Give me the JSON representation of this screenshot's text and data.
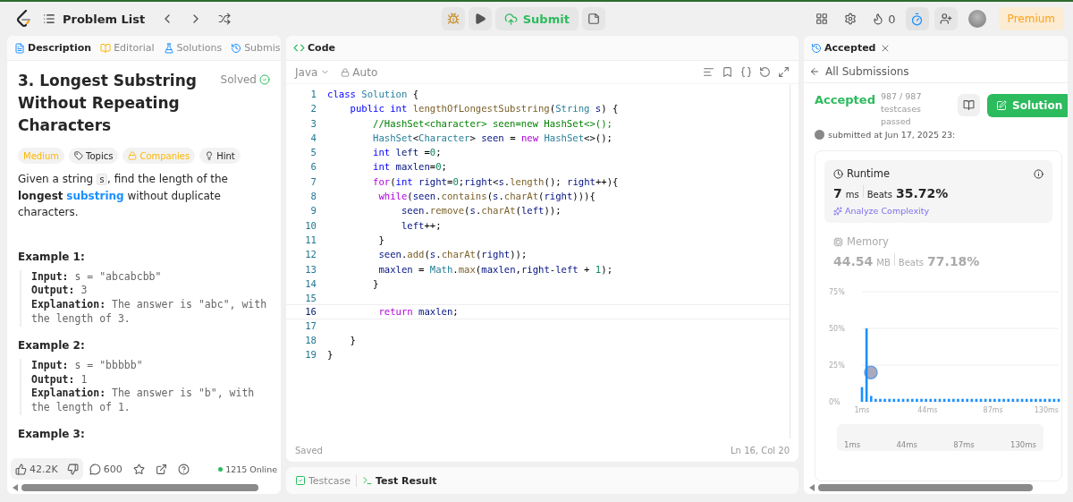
{
  "topbar": {
    "problem_list": "Problem List",
    "submit": "Submit",
    "streak": "0",
    "timer_active": true,
    "premium": "Premium"
  },
  "left_panel": {
    "tabs": [
      {
        "label": "Description",
        "selected": true
      },
      {
        "label": "Editorial",
        "selected": false
      },
      {
        "label": "Solutions",
        "selected": false
      },
      {
        "label": "Submis",
        "selected": false
      }
    ],
    "title": "3. Longest Substring Without Repeating Characters",
    "status": "Solved",
    "tags": [
      {
        "kind": "difficulty",
        "label": "Medium"
      },
      {
        "kind": "topics",
        "label": "Topics"
      },
      {
        "kind": "companies",
        "label": "Companies"
      },
      {
        "kind": "hint",
        "label": "Hint"
      }
    ],
    "description": [
      {
        "kind": "text",
        "text": "Given a string "
      },
      {
        "kind": "code",
        "text": "s"
      },
      {
        "kind": "text",
        "text": ", find the length of the **longest** "
      },
      {
        "kind": "link",
        "text": "substring"
      },
      {
        "kind": "text",
        "text": " without duplicate characters."
      }
    ],
    "examples": [
      {
        "title": "Example 1:",
        "lines": [
          {
            "label": "Input:",
            "value": " s = \"abcabcbb\""
          },
          {
            "label": "Output:",
            "value": " 3"
          },
          {
            "label": "Explanation:",
            "value": " The answer is \"abc\", with the length of 3."
          }
        ]
      },
      {
        "title": "Example 2:",
        "lines": [
          {
            "label": "Input:",
            "value": " s = \"bbbbb\""
          },
          {
            "label": "Output:",
            "value": " 1"
          },
          {
            "label": "Explanation:",
            "value": " The answer is \"b\", with the length of 1."
          }
        ]
      },
      {
        "title": "Example 3:"
      }
    ],
    "likes": "42.2K",
    "comments": "600",
    "online": "1215 Online"
  },
  "code_panel": {
    "title": "Code",
    "language": "Java",
    "mode": "Auto",
    "lines": [
      {
        "number": "1",
        "current": false,
        "tokens": [
          {
            "kind": "keyword",
            "text": "class"
          },
          {
            "kind": "type",
            "text": " Solution"
          },
          {
            "kind": "plain",
            "text": " {"
          }
        ]
      },
      {
        "number": "2",
        "current": false,
        "tokens": [
          {
            "kind": "keyword",
            "text": "    public"
          },
          {
            "kind": "keyword",
            "text": " int"
          },
          {
            "kind": "function",
            "text": " lengthOfLongestSubstring"
          },
          {
            "kind": "plain",
            "text": "("
          },
          {
            "kind": "type",
            "text": "String"
          },
          {
            "kind": "variable",
            "text": " s"
          },
          {
            "kind": "plain",
            "text": ") {"
          }
        ]
      },
      {
        "number": "3",
        "current": false,
        "tokens": [
          {
            "kind": "comment",
            "text": "        //HashSet<character> seen=new HashSet<>();"
          }
        ]
      },
      {
        "number": "4",
        "current": false,
        "tokens": [
          {
            "kind": "type",
            "text": "        HashSet"
          },
          {
            "kind": "plain",
            "text": "<"
          },
          {
            "kind": "type",
            "text": "Character"
          },
          {
            "kind": "plain",
            "text": "> "
          },
          {
            "kind": "variable",
            "text": "seen"
          },
          {
            "kind": "plain",
            "text": " = "
          },
          {
            "kind": "control",
            "text": "new"
          },
          {
            "kind": "type",
            "text": " HashSet"
          },
          {
            "kind": "plain",
            "text": "<>();"
          }
        ]
      },
      {
        "number": "5",
        "current": false,
        "tokens": [
          {
            "kind": "keyword",
            "text": "        int"
          },
          {
            "kind": "variable",
            "text": " left"
          },
          {
            "kind": "plain",
            "text": " ="
          },
          {
            "kind": "number",
            "text": "0"
          },
          {
            "kind": "plain",
            "text": ";"
          }
        ]
      },
      {
        "number": "6",
        "current": false,
        "tokens": [
          {
            "kind": "keyword",
            "text": "        int"
          },
          {
            "kind": "variable",
            "text": " maxlen"
          },
          {
            "kind": "plain",
            "text": "="
          },
          {
            "kind": "number",
            "text": "0"
          },
          {
            "kind": "plain",
            "text": ";"
          }
        ]
      },
      {
        "number": "7",
        "current": false,
        "tokens": [
          {
            "kind": "control",
            "text": "        for"
          },
          {
            "kind": "plain",
            "text": "("
          },
          {
            "kind": "keyword",
            "text": "int"
          },
          {
            "kind": "variable",
            "text": " right"
          },
          {
            "kind": "plain",
            "text": "="
          },
          {
            "kind": "number",
            "text": "0"
          },
          {
            "kind": "plain",
            "text": ";"
          },
          {
            "kind": "variable",
            "text": "right"
          },
          {
            "kind": "plain",
            "text": "<"
          },
          {
            "kind": "variable",
            "text": "s"
          },
          {
            "kind": "plain",
            "text": "."
          },
          {
            "kind": "function",
            "text": "length"
          },
          {
            "kind": "plain",
            "text": "(); "
          },
          {
            "kind": "variable",
            "text": "right"
          },
          {
            "kind": "plain",
            "text": "++){"
          }
        ]
      },
      {
        "number": "8",
        "current": false,
        "tokens": [
          {
            "kind": "control",
            "text": "         while"
          },
          {
            "kind": "plain",
            "text": "("
          },
          {
            "kind": "variable",
            "text": "seen"
          },
          {
            "kind": "plain",
            "text": "."
          },
          {
            "kind": "function",
            "text": "contains"
          },
          {
            "kind": "plain",
            "text": "("
          },
          {
            "kind": "variable",
            "text": "s"
          },
          {
            "kind": "plain",
            "text": "."
          },
          {
            "kind": "function",
            "text": "charAt"
          },
          {
            "kind": "plain",
            "text": "("
          },
          {
            "kind": "variable",
            "text": "right"
          },
          {
            "kind": "plain",
            "text": "))){"
          }
        ]
      },
      {
        "number": "9",
        "current": false,
        "tokens": [
          {
            "kind": "variable",
            "text": "             seen"
          },
          {
            "kind": "plain",
            "text": "."
          },
          {
            "kind": "function",
            "text": "remove"
          },
          {
            "kind": "plain",
            "text": "("
          },
          {
            "kind": "variable",
            "text": "s"
          },
          {
            "kind": "plain",
            "text": "."
          },
          {
            "kind": "function",
            "text": "charAt"
          },
          {
            "kind": "plain",
            "text": "("
          },
          {
            "kind": "variable",
            "text": "left"
          },
          {
            "kind": "plain",
            "text": "));"
          }
        ]
      },
      {
        "number": "10",
        "current": false,
        "tokens": [
          {
            "kind": "variable",
            "text": "             left"
          },
          {
            "kind": "plain",
            "text": "++;"
          }
        ]
      },
      {
        "number": "11",
        "current": false,
        "tokens": [
          {
            "kind": "plain",
            "text": "         }"
          }
        ]
      },
      {
        "number": "12",
        "current": false,
        "tokens": [
          {
            "kind": "variable",
            "text": "         seen"
          },
          {
            "kind": "plain",
            "text": "."
          },
          {
            "kind": "function",
            "text": "add"
          },
          {
            "kind": "plain",
            "text": "("
          },
          {
            "kind": "variable",
            "text": "s"
          },
          {
            "kind": "plain",
            "text": "."
          },
          {
            "kind": "function",
            "text": "charAt"
          },
          {
            "kind": "plain",
            "text": "("
          },
          {
            "kind": "variable",
            "text": "right"
          },
          {
            "kind": "plain",
            "text": "));"
          }
        ]
      },
      {
        "number": "13",
        "current": false,
        "tokens": [
          {
            "kind": "variable",
            "text": "         maxlen"
          },
          {
            "kind": "plain",
            "text": " = "
          },
          {
            "kind": "type",
            "text": "Math"
          },
          {
            "kind": "plain",
            "text": "."
          },
          {
            "kind": "function",
            "text": "max"
          },
          {
            "kind": "plain",
            "text": "("
          },
          {
            "kind": "variable",
            "text": "maxlen"
          },
          {
            "kind": "plain",
            "text": ","
          },
          {
            "kind": "variable",
            "text": "right"
          },
          {
            "kind": "plain",
            "text": "-"
          },
          {
            "kind": "variable",
            "text": "left"
          },
          {
            "kind": "plain",
            "text": " + "
          },
          {
            "kind": "number",
            "text": "1"
          },
          {
            "kind": "plain",
            "text": ");"
          }
        ]
      },
      {
        "number": "14",
        "current": false,
        "tokens": [
          {
            "kind": "plain",
            "text": "        }"
          }
        ]
      },
      {
        "number": "15",
        "current": false
      },
      {
        "number": "16",
        "current": true,
        "tokens": [
          {
            "kind": "control",
            "text": "         return"
          },
          {
            "kind": "variable",
            "text": " maxlen"
          },
          {
            "kind": "plain",
            "text": ";"
          }
        ]
      },
      {
        "number": "17",
        "current": false
      },
      {
        "number": "18",
        "current": false,
        "tokens": [
          {
            "kind": "plain",
            "text": "    }"
          }
        ]
      },
      {
        "number": "19",
        "current": false,
        "tokens": [
          {
            "kind": "plain",
            "text": "}"
          }
        ]
      }
    ],
    "save_status": "Saved",
    "cursor": "Ln 16, Col 20"
  },
  "bottom_tabs": [
    {
      "label": "Testcase",
      "selected": false
    },
    {
      "label": "Test Result",
      "selected": true
    }
  ],
  "right_panel": {
    "tab": "Accepted",
    "back_link": "All Submissions",
    "result": "Accepted",
    "testcases": "987 / 987 testcases passed",
    "submitted": "submitted at Jun 17, 2025 23:",
    "solution_button": "Solution",
    "metrics": [
      {
        "kind": "runtime",
        "title": "Runtime",
        "value": "7",
        "unit": "ms",
        "beats_label": "Beats",
        "beats": "35.72%",
        "selected": true,
        "link": "Analyze Complexity"
      },
      {
        "kind": "memory",
        "title": "Memory",
        "value": "44.54",
        "unit": "MB",
        "beats_label": "Beats",
        "beats": "77.18%",
        "selected": false
      }
    ],
    "chart_data": {
      "type": "bar",
      "x": [
        1,
        4,
        7,
        10,
        13,
        16,
        19,
        22,
        25,
        28,
        31,
        34,
        37,
        40,
        43,
        46,
        49,
        52,
        55,
        58,
        61,
        64,
        67,
        70,
        73,
        76,
        79,
        82,
        85,
        88,
        91,
        94,
        97,
        100,
        103,
        106,
        109,
        112,
        115,
        118,
        121,
        124,
        127,
        130
      ],
      "values": [
        10,
        50,
        4,
        2,
        2,
        2,
        2,
        2,
        2,
        2,
        2,
        2,
        2,
        2,
        2,
        2,
        2,
        2,
        2,
        2,
        2,
        2,
        2,
        2,
        2,
        2,
        2,
        2,
        2,
        2,
        2,
        2,
        2,
        2,
        2,
        2,
        2,
        2,
        2,
        2,
        2,
        2,
        2,
        2
      ],
      "xlim": [
        1,
        130
      ],
      "ylim": [
        0,
        75
      ],
      "yticks": [
        {
          "value": 0,
          "label": "0%"
        },
        {
          "value": 25,
          "label": "25%"
        },
        {
          "value": 50,
          "label": "50%"
        },
        {
          "value": 75,
          "label": "75%"
        }
      ],
      "xticks": [
        {
          "value": 1,
          "label": "1ms"
        },
        {
          "value": 44,
          "label": "44ms"
        },
        {
          "value": 87,
          "label": "87ms"
        },
        {
          "value": 130,
          "label": "130ms"
        }
      ]
    },
    "range_labels": [
      "1ms",
      "44ms",
      "87ms",
      "130ms"
    ]
  }
}
